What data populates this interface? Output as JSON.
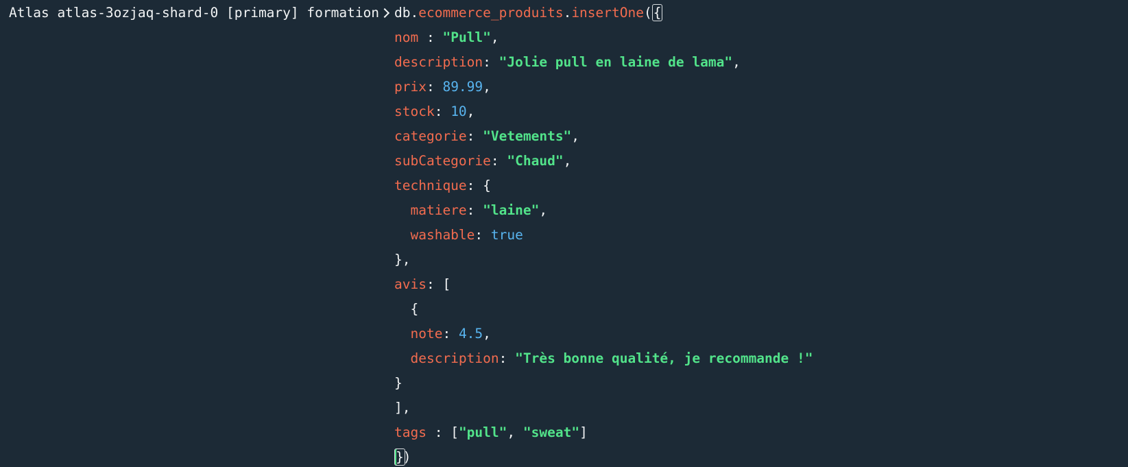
{
  "prompt": {
    "text": "Atlas atlas-3ozjaq-shard-0 [primary] formation",
    "arrow_icon": "chevron-right-icon"
  },
  "code": {
    "head": {
      "db": "db",
      "dot1": ".",
      "collection": "ecommerce_produits",
      "dot2": ".",
      "method": "insertOne",
      "open_paren": "(",
      "open_brace": "{"
    },
    "lines": {
      "nom_key": "nom",
      "nom_sep": " : ",
      "nom_val": "\"Pull\"",
      "nom_end": ",",
      "description_key": "description",
      "description_sep": ": ",
      "description_val": "\"Jolie pull en laine de lama\"",
      "description_end": ",",
      "prix_key": "prix",
      "prix_sep": ": ",
      "prix_val": "89.99",
      "prix_end": ",",
      "stock_key": "stock",
      "stock_sep": ": ",
      "stock_val": "10",
      "stock_end": ",",
      "categorie_key": "categorie",
      "categorie_sep": ": ",
      "categorie_val": "\"Vetements\"",
      "categorie_end": ",",
      "subCategorie_key": "subCategorie",
      "subCategorie_sep": ": ",
      "subCategorie_val": "\"Chaud\"",
      "subCategorie_end": ",",
      "technique_key": "technique",
      "technique_sep": ": {",
      "matiere_indent": "  ",
      "matiere_key": "matiere",
      "matiere_sep": ": ",
      "matiere_val": "\"laine\"",
      "matiere_end": ",",
      "washable_indent": "  ",
      "washable_key": "washable",
      "washable_sep": ": ",
      "washable_val": "true",
      "technique_close": "},",
      "avis_key": "avis",
      "avis_sep": ": [",
      "avis_obj_open": "  {",
      "note_indent": "  ",
      "note_key": "note",
      "note_sep": ": ",
      "note_val": "4.5",
      "note_end": ",",
      "avis_desc_indent": "  ",
      "avis_desc_key": "description",
      "avis_desc_sep": ": ",
      "avis_desc_val": "\"Très bonne qualité, je recommande !\"",
      "avis_obj_close": "}",
      "avis_close": "],",
      "tags_key": "tags",
      "tags_sep": " : [",
      "tags_val1": "\"pull\"",
      "tags_comma": ", ",
      "tags_val2": "\"sweat\"",
      "tags_close": "]",
      "final_brace": "}",
      "final_paren": ")"
    }
  },
  "colors": {
    "background": "#1c2a36",
    "text": "#f2f4f5",
    "key": "#f26c4f",
    "string": "#52e38a",
    "number": "#58b4ef"
  }
}
